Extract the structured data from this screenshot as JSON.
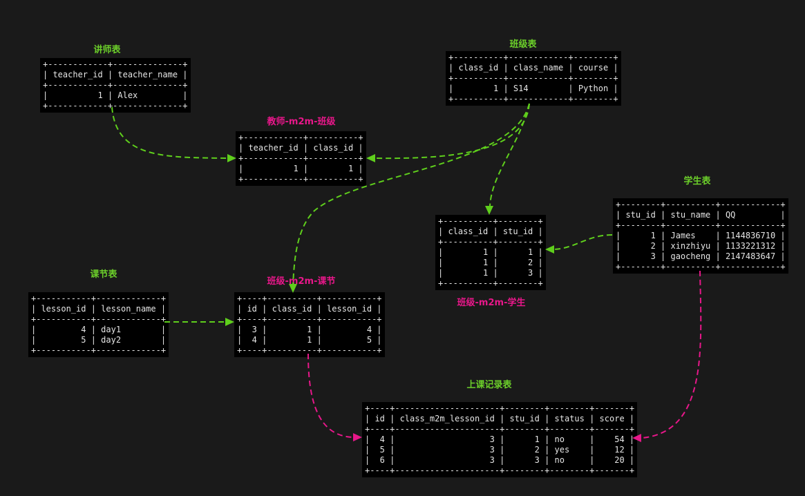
{
  "tables": {
    "teacher": {
      "caption": "讲师表",
      "columns": [
        "teacher_id",
        "teacher_name"
      ],
      "align": [
        "r",
        "l"
      ],
      "rows": [
        [
          "1",
          "Alex"
        ]
      ]
    },
    "class": {
      "caption": "班级表",
      "columns": [
        "class_id",
        "class_name",
        "course"
      ],
      "align": [
        "r",
        "l",
        "l"
      ],
      "rows": [
        [
          "1",
          "S14",
          "Python"
        ]
      ]
    },
    "teacher_class": {
      "caption": "教师-m2m-班级",
      "columns": [
        "teacher_id",
        "class_id"
      ],
      "align": [
        "r",
        "r"
      ],
      "rows": [
        [
          "1",
          "1"
        ]
      ]
    },
    "student": {
      "caption": "学生表",
      "columns": [
        "stu_id",
        "stu_name",
        "QQ"
      ],
      "align": [
        "r",
        "l",
        "l"
      ],
      "rows": [
        [
          "1",
          "James",
          "1144836710"
        ],
        [
          "2",
          "xinzhiyu",
          "1133221312"
        ],
        [
          "3",
          "gaocheng",
          "2147483647"
        ]
      ]
    },
    "class_student": {
      "caption": "班级-m2m-学生",
      "columns": [
        "class_id",
        "stu_id"
      ],
      "align": [
        "r",
        "r"
      ],
      "rows": [
        [
          "1",
          "1"
        ],
        [
          "1",
          "2"
        ],
        [
          "1",
          "3"
        ]
      ]
    },
    "lesson": {
      "caption": "课节表",
      "columns": [
        "lesson_id",
        "lesson_name"
      ],
      "align": [
        "r",
        "l"
      ],
      "rows": [
        [
          "4",
          "day1"
        ],
        [
          "5",
          "day2"
        ]
      ]
    },
    "class_lesson": {
      "caption": "班级-m2m-课节",
      "columns": [
        "id",
        "class_id",
        "lesson_id"
      ],
      "align": [
        "r",
        "r",
        "r"
      ],
      "rows": [
        [
          "3",
          "1",
          "4"
        ],
        [
          "4",
          "1",
          "5"
        ]
      ]
    },
    "record": {
      "caption": "上课记录表",
      "columns": [
        "id",
        "class_m2m_lesson_id",
        "stu_id",
        "status",
        "score"
      ],
      "align": [
        "r",
        "r",
        "r",
        "l",
        "r"
      ],
      "rows": [
        [
          "4",
          "3",
          "1",
          "no",
          "54"
        ],
        [
          "5",
          "3",
          "2",
          "yes",
          "12"
        ],
        [
          "6",
          "3",
          "3",
          "no",
          "20"
        ]
      ]
    }
  },
  "colors": {
    "background": "#1a1a1a",
    "table_caption": "#6ccf2a",
    "link_caption": "#e8178a",
    "green_arrow": "#5fcf1c",
    "pink_arrow": "#e8178a"
  }
}
